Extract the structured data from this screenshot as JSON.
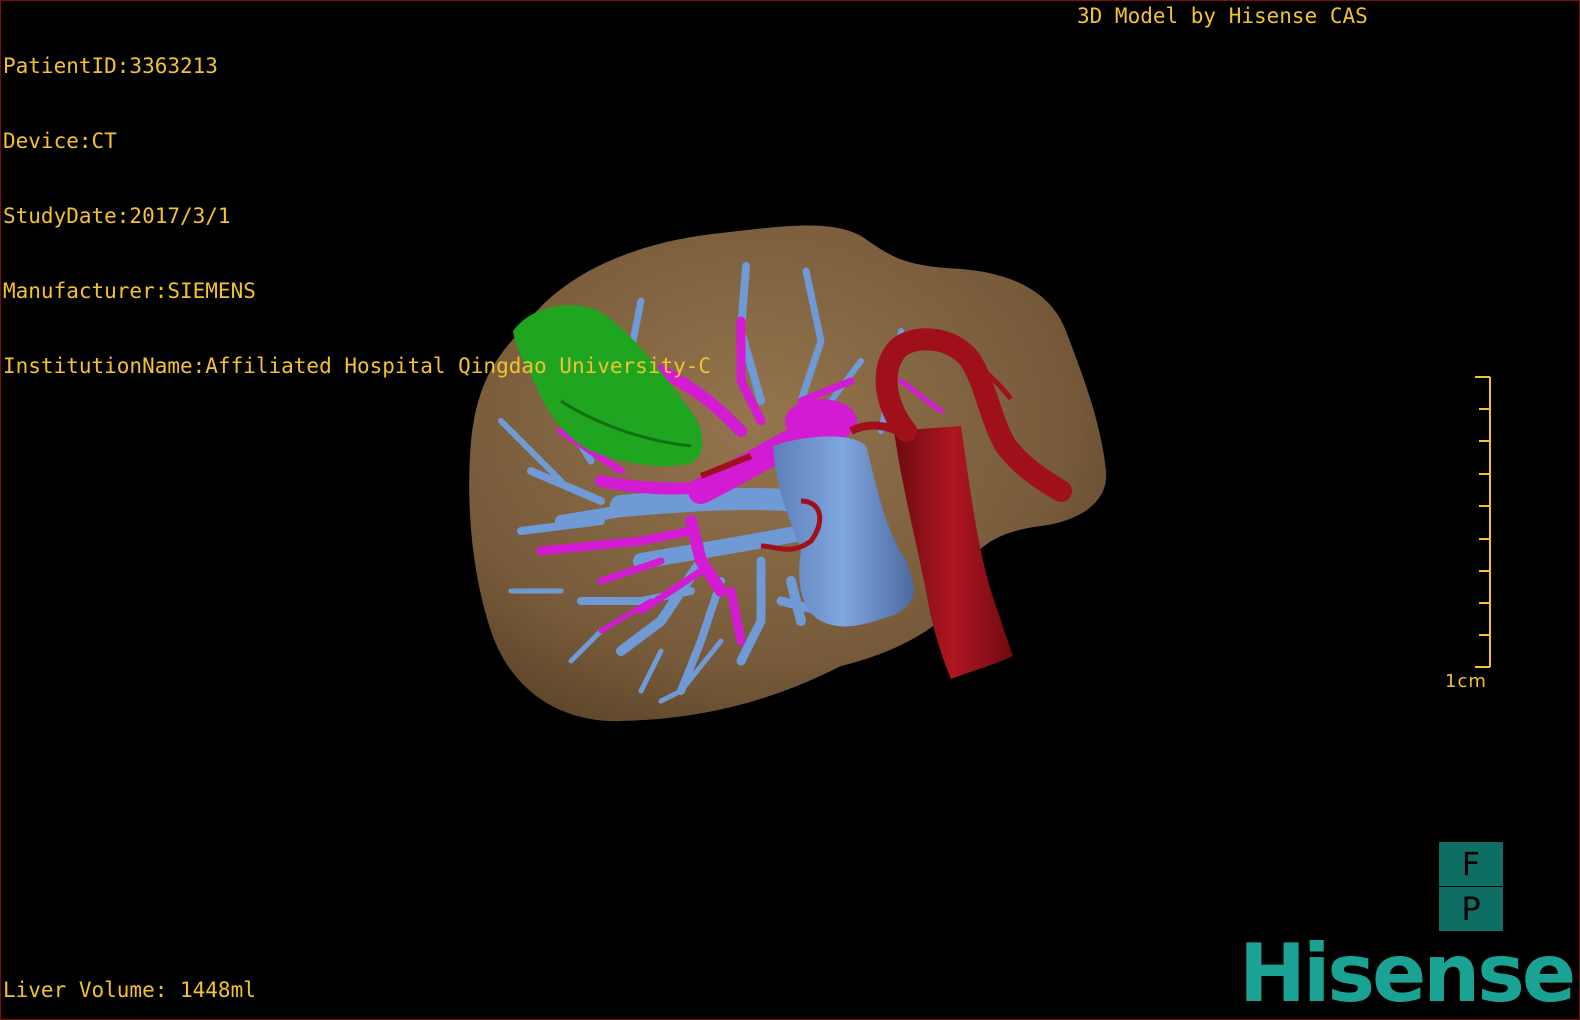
{
  "patient_info": {
    "patient_id": "PatientID:3363213",
    "device": "Device:CT",
    "study_date": "StudyDate:2017/3/1",
    "manufacturer": "Manufacturer:SIEMENS",
    "institution": "InstitutionName:Affiliated Hospital Qingdao University-C"
  },
  "brand_caption": "3D Model by Hisense CAS",
  "liver_volume": "Liver Volume: 1448ml",
  "scale": {
    "label": "1cm",
    "color": "#f2c230"
  },
  "orientation": {
    "top": "F",
    "bottom": "P"
  },
  "logo_text": "Hisense",
  "colors": {
    "text": "#f2c230",
    "liver": "#8a6a44",
    "gallbladder": "#1fa51f",
    "hepatic_vein": "#6f9ad6",
    "portal_vein": "#d21bd2",
    "artery": "#a0101a",
    "logo": "#1aa394"
  }
}
